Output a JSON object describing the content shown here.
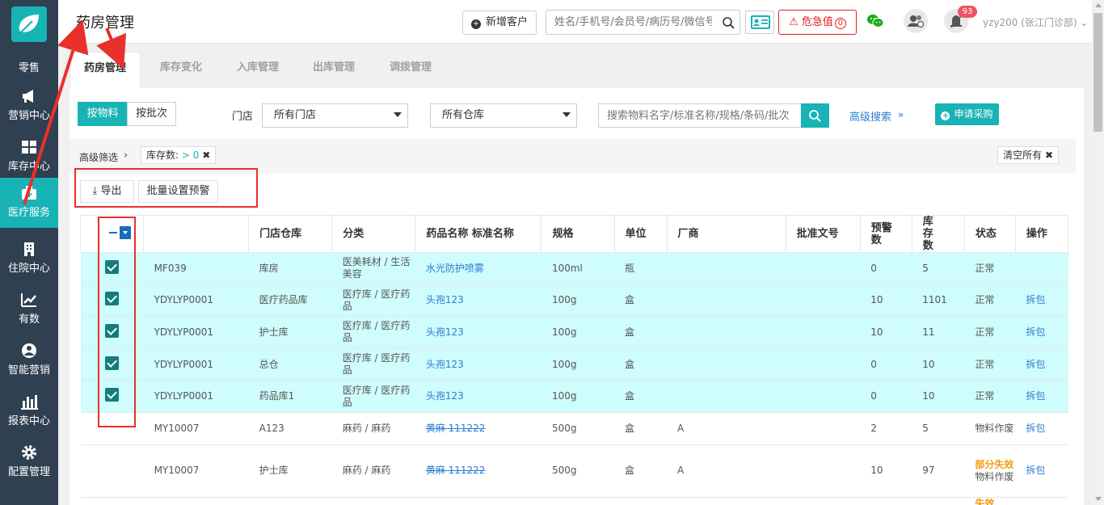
{
  "sidebar": {
    "items": [
      {
        "label": "零售",
        "icon": "leaf-logo-icon"
      },
      {
        "label": "营销中心",
        "icon": "megaphone-icon"
      },
      {
        "label": "库存中心",
        "icon": "grid-icon"
      },
      {
        "label": "医疗服务",
        "icon": "medical-kit-icon",
        "active": true
      },
      {
        "label": "住院中心",
        "icon": "hospital-building-icon"
      },
      {
        "label": "有数",
        "icon": "trend-chart-icon"
      },
      {
        "label": "智能营销",
        "icon": "smart-marketing-icon"
      },
      {
        "label": "报表中心",
        "icon": "bar-chart-icon"
      },
      {
        "label": "配置管理",
        "icon": "gear-icon"
      }
    ]
  },
  "topbar": {
    "title": "药房管理",
    "add_customer": "新增客户",
    "search_placeholder": "姓名/手机号/会员号/病历号/微信号",
    "critical_label": "危急值",
    "critical_count": "0",
    "notification_count": "93",
    "user": "yzy200 (张江门诊部)"
  },
  "tabs": [
    "药房管理",
    "库存变化",
    "入库管理",
    "出库管理",
    "调拨管理"
  ],
  "filters": {
    "mode_material": "按物料",
    "mode_batch": "按批次",
    "store_label": "门店",
    "store_value": "所有门店",
    "warehouse_value": "所有仓库",
    "search_placeholder": "搜索物料名字/标准名称/规格/条码/批次",
    "advanced": "高级搜索",
    "apply_purchase": "申请采购"
  },
  "filterbar": {
    "label": "高级筛选",
    "chip_label": "库存数:",
    "chip_value": "> 0",
    "clear_all": "清空所有"
  },
  "actions": {
    "export": "导出",
    "batch_alert": "批量设置预警"
  },
  "table": {
    "headers": [
      "",
      "",
      "门店仓库",
      "分类",
      "药品名称 标准名称",
      "规格",
      "单位",
      "厂商",
      "批准文号",
      "预警数",
      "库存数",
      "状态",
      "操作"
    ],
    "rows": [
      {
        "checked": true,
        "code": "MF039",
        "warehouse": "库房",
        "category": "医美耗材 / 生活美容",
        "name": "水光防护喷雾",
        "spec": "100ml",
        "unit": "瓶",
        "maker": "",
        "approval": "",
        "alert": "0",
        "stock": "5",
        "status": "正常",
        "status2": "",
        "op": ""
      },
      {
        "checked": true,
        "code": "YDYLYP0001",
        "warehouse": "医疗药品库",
        "category": "医疗库 / 医疗药品",
        "name": "头孢123",
        "spec": "100g",
        "unit": "盒",
        "maker": "",
        "approval": "",
        "alert": "10",
        "stock": "1101",
        "status": "正常",
        "status2": "",
        "op": "拆包"
      },
      {
        "checked": true,
        "code": "YDYLYP0001",
        "warehouse": "护士库",
        "category": "医疗库 / 医疗药品",
        "name": "头孢123",
        "spec": "100g",
        "unit": "盒",
        "maker": "",
        "approval": "",
        "alert": "10",
        "stock": "11",
        "status": "正常",
        "status2": "",
        "op": "拆包"
      },
      {
        "checked": true,
        "code": "YDYLYP0001",
        "warehouse": "总仓",
        "category": "医疗库 / 医疗药品",
        "name": "头孢123",
        "spec": "100g",
        "unit": "盒",
        "maker": "",
        "approval": "",
        "alert": "0",
        "stock": "10",
        "status": "正常",
        "status2": "",
        "op": "拆包"
      },
      {
        "checked": true,
        "code": "YDYLYP0001",
        "warehouse": "药品库1",
        "category": "医疗库 / 医疗药品",
        "name": "头孢123",
        "spec": "100g",
        "unit": "盒",
        "maker": "",
        "approval": "",
        "alert": "0",
        "stock": "10",
        "status": "正常",
        "status2": "",
        "op": "拆包"
      },
      {
        "checked": false,
        "code": "MY10007",
        "warehouse": "A123",
        "category": "麻药 / 麻药",
        "name": "黄麻 111222",
        "spec": "500g",
        "unit": "盒",
        "maker": "A",
        "approval": "",
        "alert": "2",
        "stock": "5",
        "status": "物料作废",
        "status2": "",
        "op": "拆包"
      },
      {
        "checked": false,
        "code": "MY10007",
        "warehouse": "护士库",
        "category": "麻药 / 麻药",
        "name": "黄麻 111222",
        "spec": "500g",
        "unit": "盒",
        "maker": "A",
        "approval": "",
        "alert": "10",
        "stock": "97",
        "status": "部分失效",
        "status2": "物料作废",
        "op": "拆包"
      },
      {
        "checked": false,
        "code": "",
        "warehouse": "",
        "category": "",
        "name": "",
        "spec": "",
        "unit": "",
        "maker": "",
        "approval": "",
        "alert": "",
        "stock": "",
        "status": "失效",
        "status2": "",
        "op": ""
      }
    ]
  },
  "colors": {
    "sidebar": "#2f4050",
    "accent": "#18b3b5",
    "selected_row": "#cffcfc",
    "danger": "#e02020",
    "annotation": "#e8312a",
    "link": "#2b7cd3",
    "warning": "#f39c12"
  }
}
